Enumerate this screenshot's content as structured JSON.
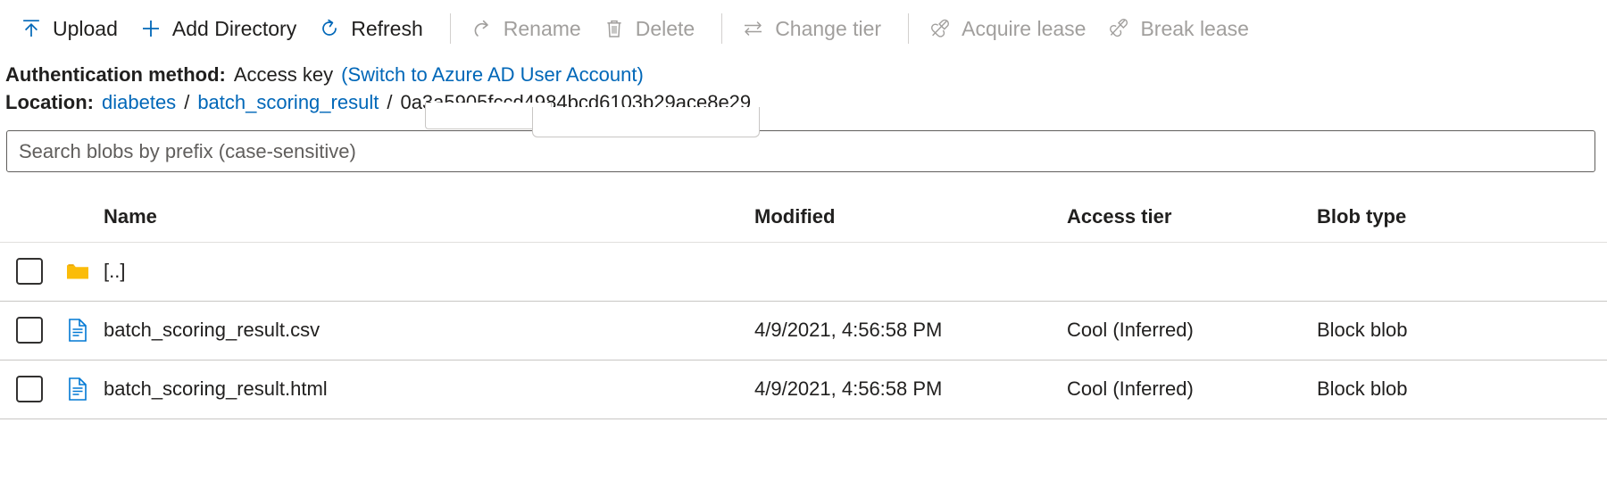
{
  "toolbar": {
    "items": [
      {
        "label": "Upload",
        "icon": "upload-icon",
        "disabled": false
      },
      {
        "label": "Add Directory",
        "icon": "plus-icon",
        "disabled": false
      },
      {
        "label": "Refresh",
        "icon": "refresh-icon",
        "disabled": false
      },
      {
        "label": "Rename",
        "icon": "rename-icon",
        "disabled": true
      },
      {
        "label": "Delete",
        "icon": "trash-icon",
        "disabled": true
      },
      {
        "label": "Change tier",
        "icon": "swap-arrows-icon",
        "disabled": true
      },
      {
        "label": "Acquire lease",
        "icon": "lease-plug-icon",
        "disabled": true
      },
      {
        "label": "Break lease",
        "icon": "break-lease-icon",
        "disabled": true
      }
    ]
  },
  "auth": {
    "label": "Authentication method:",
    "value": "Access key",
    "switch_link": "(Switch to Azure AD User Account)"
  },
  "location": {
    "label": "Location:",
    "crumb_1": "diabetes",
    "crumb_2": "batch_scoring_result",
    "separator": "/",
    "guid": "0a3a5905fccd4984bcd6103b29ace8e29"
  },
  "search": {
    "placeholder": "Search blobs by prefix (case-sensitive)",
    "value": ""
  },
  "table": {
    "columns": [
      "Name",
      "Modified",
      "Access tier",
      "Blob type"
    ],
    "rows": [
      {
        "icon": "folder-icon",
        "name": "[..]",
        "modified": "",
        "access_tier": "",
        "blob_type": ""
      },
      {
        "icon": "file-icon",
        "name": "batch_scoring_result.csv",
        "modified": "4/9/2021, 4:56:58 PM",
        "access_tier": "Cool (Inferred)",
        "blob_type": "Block blob"
      },
      {
        "icon": "file-icon",
        "name": "batch_scoring_result.html",
        "modified": "4/9/2021, 4:56:58 PM",
        "access_tier": "Cool (Inferred)",
        "blob_type": "Block blob"
      }
    ]
  },
  "colors": {
    "accent_blue": "#0067b8",
    "link_blue": "#0067b8",
    "folder_amber": "#fbbc09",
    "disabled_gray": "#a19f9d",
    "text": "#201f1e"
  }
}
